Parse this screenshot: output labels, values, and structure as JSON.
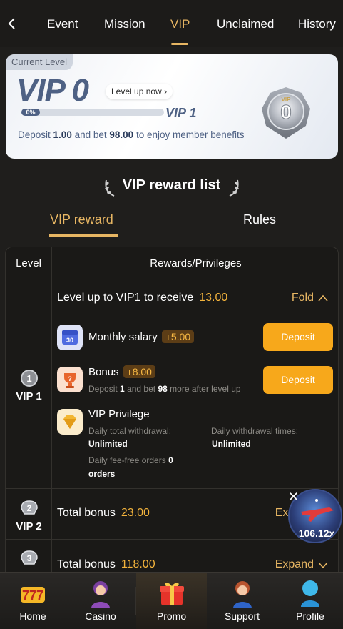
{
  "tabs": [
    {
      "label": "Event",
      "active": false
    },
    {
      "label": "Mission",
      "active": false
    },
    {
      "label": "VIP",
      "active": true
    },
    {
      "label": "Unclaimed",
      "active": false
    },
    {
      "label": "History",
      "active": false
    }
  ],
  "level_card": {
    "tag": "Current Level",
    "current_level": "VIP 0",
    "level_up_label": "Level up now",
    "progress_percent": 0,
    "progress_label": "0%",
    "next_level": "VIP 1",
    "deposit_prefix": "Deposit",
    "deposit_amount": "1.00",
    "bet_prefix": "and bet",
    "bet_amount": "98.00",
    "deposit_suffix": "to enjoy member benefits",
    "badge_tag": "VIP",
    "badge_number": "0"
  },
  "reward_list": {
    "title": "VIP reward list",
    "tabs": [
      "VIP reward",
      "Rules"
    ],
    "col_level": "Level",
    "col_rewards": "Rewards/Privileges",
    "rows": [
      {
        "level": "VIP 1",
        "level_num": "1",
        "title": "Level up to VIP1 to receive",
        "amount": "13.00",
        "toggle": "Fold",
        "salary": {
          "name": "Monthly salary",
          "value": "+5.00",
          "button": "Deposit",
          "icon_day": "30"
        },
        "bonus": {
          "name": "Bonus",
          "value": "+8.00",
          "button": "Deposit",
          "note_a": "Deposit",
          "note_dep": "1",
          "note_b": "and bet",
          "note_bet": "98",
          "note_c": "more after level up"
        },
        "privilege": {
          "name": "VIP Privilege",
          "withdrawal_label": "Daily total withdrawal:",
          "withdrawal_value": "Unlimited",
          "times_label": "Daily withdrawal times:",
          "times_value": "Unlimited",
          "fee_label": "Daily fee-free orders",
          "fee_value": "0",
          "fee_unit": "orders"
        }
      },
      {
        "level": "VIP 2",
        "level_num": "2",
        "title": "Total bonus",
        "amount": "23.00",
        "toggle": "Expand"
      },
      {
        "level": "VIP 3",
        "level_num": "3",
        "title": "Total bonus",
        "amount": "118.00",
        "toggle": "Expand"
      }
    ]
  },
  "floater": {
    "multiplier": "106.12x"
  },
  "bottom_nav": [
    {
      "label": "Home",
      "active": false
    },
    {
      "label": "Casino",
      "active": false
    },
    {
      "label": "Promo",
      "active": true
    },
    {
      "label": "Support",
      "active": false
    },
    {
      "label": "Profile",
      "active": false
    }
  ],
  "colors": {
    "accent": "#e7b663",
    "amount": "#f3b33c",
    "button": "#f7a81b",
    "card_text": "#4e6184"
  }
}
